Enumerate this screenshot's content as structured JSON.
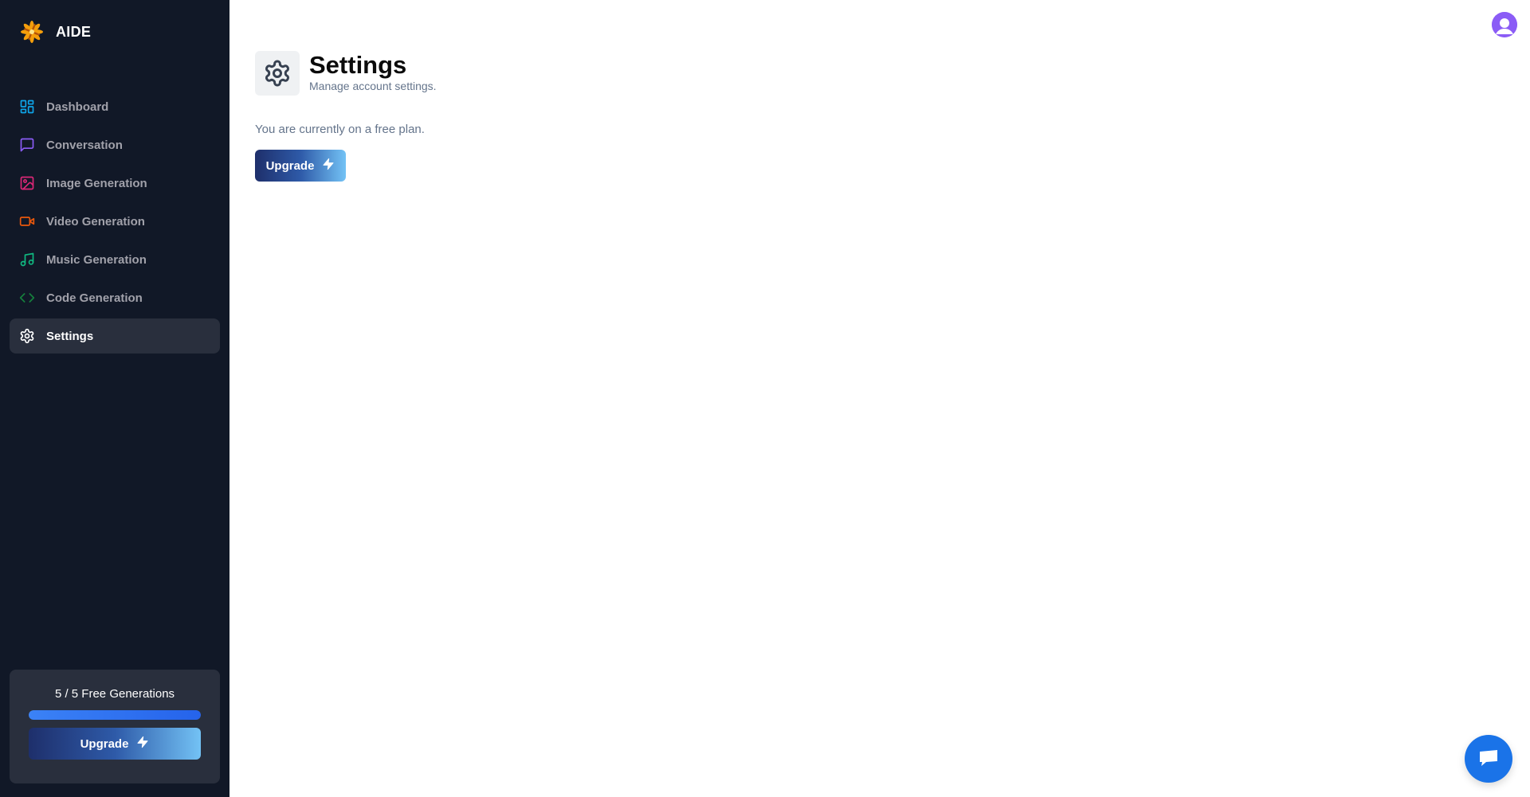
{
  "brand": {
    "name": "AIDE",
    "icon": "aide-logo-icon"
  },
  "sidebar": {
    "items": [
      {
        "label": "Dashboard",
        "icon": "layout-dashboard-icon",
        "color": "#0ea5e9"
      },
      {
        "label": "Conversation",
        "icon": "message-square-icon",
        "color": "#8b5cf6"
      },
      {
        "label": "Image Generation",
        "icon": "image-icon",
        "color": "#db2777"
      },
      {
        "label": "Video Generation",
        "icon": "video-icon",
        "color": "#ea580c"
      },
      {
        "label": "Music Generation",
        "icon": "music-icon",
        "color": "#10b981"
      },
      {
        "label": "Code Generation",
        "icon": "code-icon",
        "color": "#15803d"
      },
      {
        "label": "Settings",
        "icon": "settings-icon",
        "color": "#ffffff",
        "active": true
      }
    ],
    "free_counter": {
      "text": "5 / 5 Free Generations",
      "used": 5,
      "limit": 5,
      "progress": 1.0
    },
    "upgrade_label": "Upgrade"
  },
  "main": {
    "title": "Settings",
    "subtitle": "Manage account settings.",
    "plan_text": "You are currently on a free plan.",
    "upgrade_label": "Upgrade"
  },
  "colors": {
    "sidebar_bg": "#111827",
    "avatar": "#8b5cf6",
    "chat_bubble": "#1a73e8",
    "progress": "#3b82f6"
  }
}
